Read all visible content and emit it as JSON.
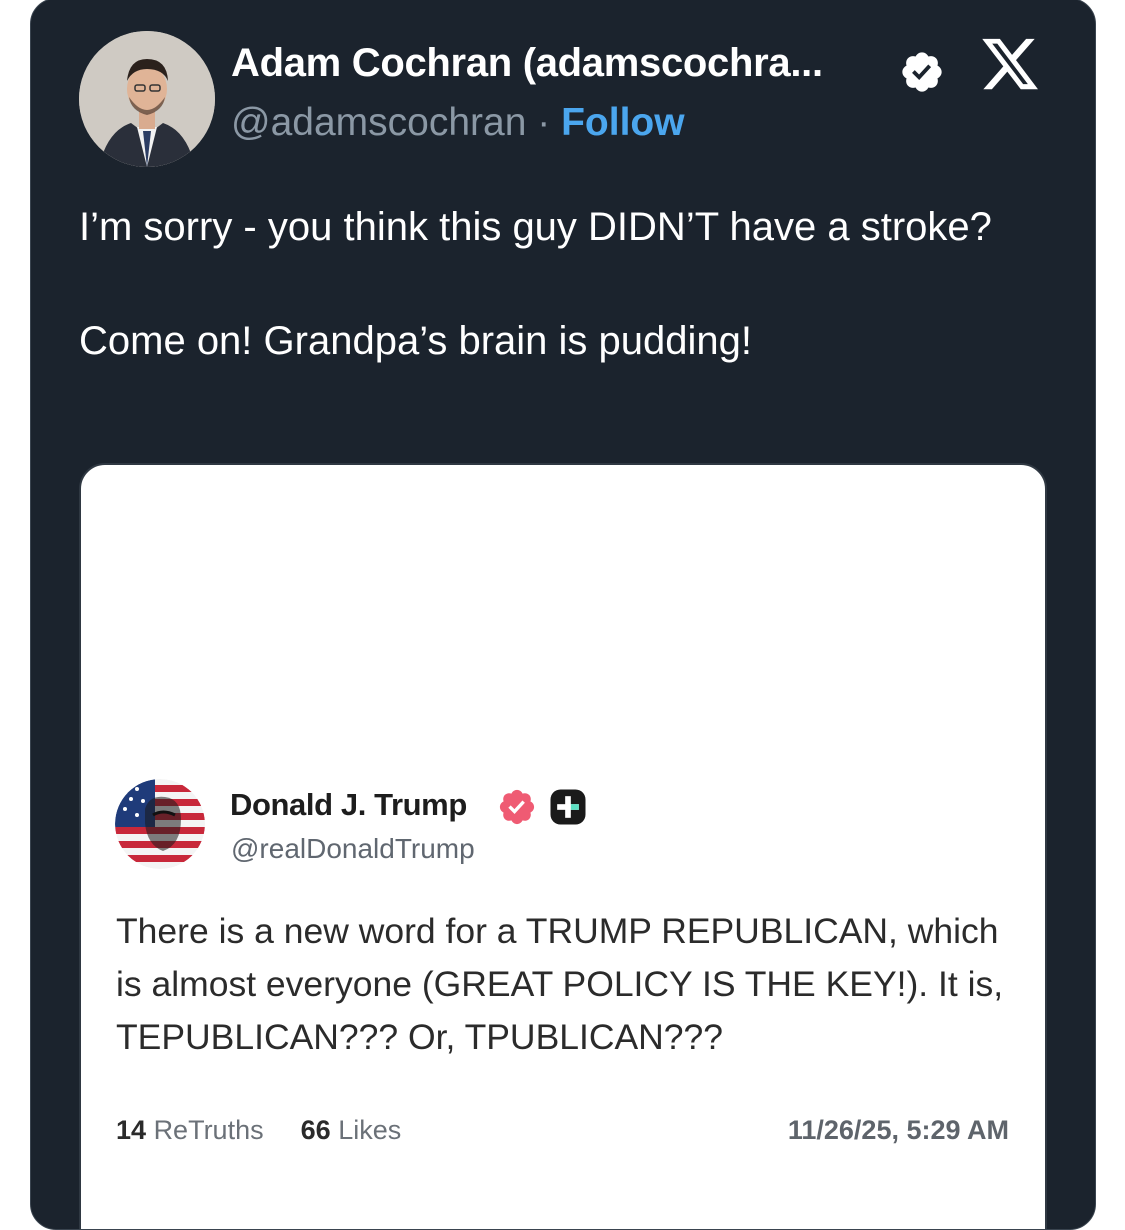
{
  "author": {
    "name": "Adam Cochran (adamscochra...",
    "handle": "@adamscochran",
    "separator": "·",
    "follow_label": "Follow",
    "verified_icon": "verified-badge-icon",
    "avatar": "profile-photo"
  },
  "platform_logo": "x-logo-icon",
  "tweet": {
    "paragraph1": "I’m sorry - you think this guy DIDN’T have a stroke?",
    "paragraph2": "Come on! Grandpa’s brain is pudding!"
  },
  "embedded_post": {
    "name": "Donald J. Trump",
    "handle": "@realDonaldTrump",
    "text": "There is a new word for a TRUMP REPUBLICAN, which is almost everyone (GREAT POLICY IS THE KEY!). It is, TEPUBLICAN??? Or, TPUBLICAN???",
    "retruths_count": "14",
    "retruths_label": "ReTruths",
    "likes_count": "66",
    "likes_label": "Likes",
    "timestamp": "11/26/25, 5:29 AM"
  },
  "colors": {
    "card_bg": "#1b232d",
    "follow": "#4ba6ee",
    "truth_verified": "#ef5b73"
  }
}
